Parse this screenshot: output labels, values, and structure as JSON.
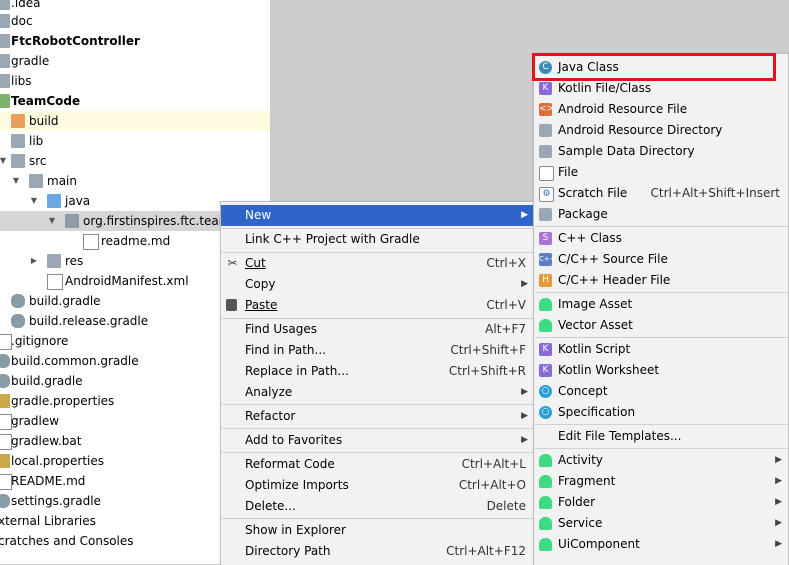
{
  "project_tree": {
    "items": [
      {
        "label": ".idea",
        "bold": false,
        "icon": "folder-icon"
      },
      {
        "label": "doc",
        "bold": false,
        "icon": "folder-icon"
      },
      {
        "label": "FtcRobotController",
        "bold": true,
        "icon": "module-icon"
      },
      {
        "label": "gradle",
        "bold": false,
        "icon": "folder-icon"
      },
      {
        "label": "libs",
        "bold": false,
        "icon": "folder-icon"
      },
      {
        "label": "TeamCode",
        "bold": true,
        "icon": "module-icon"
      },
      {
        "label": "build",
        "bold": false,
        "icon": "folder-icon"
      },
      {
        "label": "lib",
        "bold": false,
        "icon": "folder-icon"
      },
      {
        "label": "src",
        "bold": false,
        "icon": "folder-icon"
      },
      {
        "label": "main",
        "bold": false,
        "icon": "folder-icon"
      },
      {
        "label": "java",
        "bold": false,
        "icon": "folder-icon"
      },
      {
        "label": "org.firstinspires.ftc.teamco",
        "bold": false,
        "icon": "package-icon"
      },
      {
        "label": "readme.md",
        "bold": false,
        "icon": "markdown-file-icon"
      },
      {
        "label": "res",
        "bold": false,
        "icon": "folder-icon"
      },
      {
        "label": "AndroidManifest.xml",
        "bold": false,
        "icon": "manifest-file-icon"
      },
      {
        "label": "build.gradle",
        "bold": false,
        "icon": "gradle-icon"
      },
      {
        "label": "build.release.gradle",
        "bold": false,
        "icon": "gradle-icon"
      },
      {
        "label": ".gitignore",
        "bold": false,
        "icon": "gitignore-icon"
      },
      {
        "label": "build.common.gradle",
        "bold": false,
        "icon": "gradle-icon"
      },
      {
        "label": "build.gradle",
        "bold": false,
        "icon": "gradle-icon"
      },
      {
        "label": "gradle.properties",
        "bold": false,
        "icon": "properties-icon"
      },
      {
        "label": "gradlew",
        "bold": false,
        "icon": "file-icon"
      },
      {
        "label": "gradlew.bat",
        "bold": false,
        "icon": "file-icon"
      },
      {
        "label": "local.properties",
        "bold": false,
        "icon": "properties-icon"
      },
      {
        "label": "README.md",
        "bold": false,
        "icon": "markdown-file-icon"
      },
      {
        "label": "settings.gradle",
        "bold": false,
        "icon": "gradle-icon"
      },
      {
        "label": "xternal Libraries",
        "bold": false,
        "icon": "libraries-icon"
      },
      {
        "label": "cratches and Consoles",
        "bold": false,
        "icon": "scratches-icon"
      }
    ]
  },
  "context_menu": {
    "items": [
      {
        "label": "New",
        "shortcut": "",
        "submenu": true,
        "active": true
      },
      {
        "label": "Link C++ Project with Gradle",
        "shortcut": "",
        "submenu": false
      },
      {
        "label": "Cut",
        "shortcut": "Ctrl+X",
        "submenu": false,
        "icon": "scissors-icon"
      },
      {
        "label": "Copy",
        "shortcut": "",
        "submenu": true
      },
      {
        "label": "Paste",
        "shortcut": "Ctrl+V",
        "submenu": false,
        "icon": "clipboard-icon"
      },
      {
        "label": "Find Usages",
        "shortcut": "Alt+F7",
        "submenu": false
      },
      {
        "label": "Find in Path...",
        "shortcut": "Ctrl+Shift+F",
        "submenu": false
      },
      {
        "label": "Replace in Path...",
        "shortcut": "Ctrl+Shift+R",
        "submenu": false
      },
      {
        "label": "Analyze",
        "shortcut": "",
        "submenu": true
      },
      {
        "label": "Refactor",
        "shortcut": "",
        "submenu": true
      },
      {
        "label": "Add to Favorites",
        "shortcut": "",
        "submenu": true
      },
      {
        "label": "Reformat Code",
        "shortcut": "Ctrl+Alt+L",
        "submenu": false
      },
      {
        "label": "Optimize Imports",
        "shortcut": "Ctrl+Alt+O",
        "submenu": false
      },
      {
        "label": "Delete...",
        "shortcut": "Delete",
        "submenu": false
      },
      {
        "label": "Show in Explorer",
        "shortcut": "",
        "submenu": false
      },
      {
        "label": "Directory Path",
        "shortcut": "Ctrl+Alt+F12",
        "submenu": false
      }
    ]
  },
  "new_submenu": {
    "items": [
      {
        "label": "Java Class",
        "shortcut": "",
        "submenu": false,
        "icon": "java-class-icon",
        "highlighted": true
      },
      {
        "label": "Kotlin File/Class",
        "shortcut": "",
        "submenu": false,
        "icon": "kotlin-icon"
      },
      {
        "label": "Android Resource File",
        "shortcut": "",
        "submenu": false,
        "icon": "android-resource-file-icon"
      },
      {
        "label": "Android Resource Directory",
        "shortcut": "",
        "submenu": false,
        "icon": "folder-icon"
      },
      {
        "label": "Sample Data Directory",
        "shortcut": "",
        "submenu": false,
        "icon": "folder-icon"
      },
      {
        "label": "File",
        "shortcut": "",
        "submenu": false,
        "icon": "file-icon"
      },
      {
        "label": "Scratch File",
        "shortcut": "Ctrl+Alt+Shift+Insert",
        "submenu": false,
        "icon": "scratch-file-icon"
      },
      {
        "label": "Package",
        "shortcut": "",
        "submenu": false,
        "icon": "package-icon"
      },
      {
        "label": "C++ Class",
        "shortcut": "",
        "submenu": false,
        "icon": "cpp-class-icon"
      },
      {
        "label": "C/C++ Source File",
        "shortcut": "",
        "submenu": false,
        "icon": "cpp-source-icon"
      },
      {
        "label": "C/C++ Header File",
        "shortcut": "",
        "submenu": false,
        "icon": "cpp-header-icon"
      },
      {
        "label": "Image Asset",
        "shortcut": "",
        "submenu": false,
        "icon": "android-icon"
      },
      {
        "label": "Vector Asset",
        "shortcut": "",
        "submenu": false,
        "icon": "android-icon"
      },
      {
        "label": "Kotlin Script",
        "shortcut": "",
        "submenu": false,
        "icon": "kotlin-icon"
      },
      {
        "label": "Kotlin Worksheet",
        "shortcut": "",
        "submenu": false,
        "icon": "kotlin-icon"
      },
      {
        "label": "Concept",
        "shortcut": "",
        "submenu": false,
        "icon": "concept-icon"
      },
      {
        "label": "Specification",
        "shortcut": "",
        "submenu": false,
        "icon": "concept-icon"
      },
      {
        "label": "Edit File Templates...",
        "shortcut": "",
        "submenu": false
      },
      {
        "label": "Activity",
        "shortcut": "",
        "submenu": true,
        "icon": "android-icon"
      },
      {
        "label": "Fragment",
        "shortcut": "",
        "submenu": true,
        "icon": "android-icon"
      },
      {
        "label": "Folder",
        "shortcut": "",
        "submenu": true,
        "icon": "android-icon"
      },
      {
        "label": "Service",
        "shortcut": "",
        "submenu": true,
        "icon": "android-icon"
      },
      {
        "label": "UiComponent",
        "shortcut": "",
        "submenu": true,
        "icon": "android-icon"
      }
    ]
  },
  "colors": {
    "menu_active": "#2f65ca",
    "highlight_box": "#e0141e",
    "android_green": "#3ddc84"
  }
}
